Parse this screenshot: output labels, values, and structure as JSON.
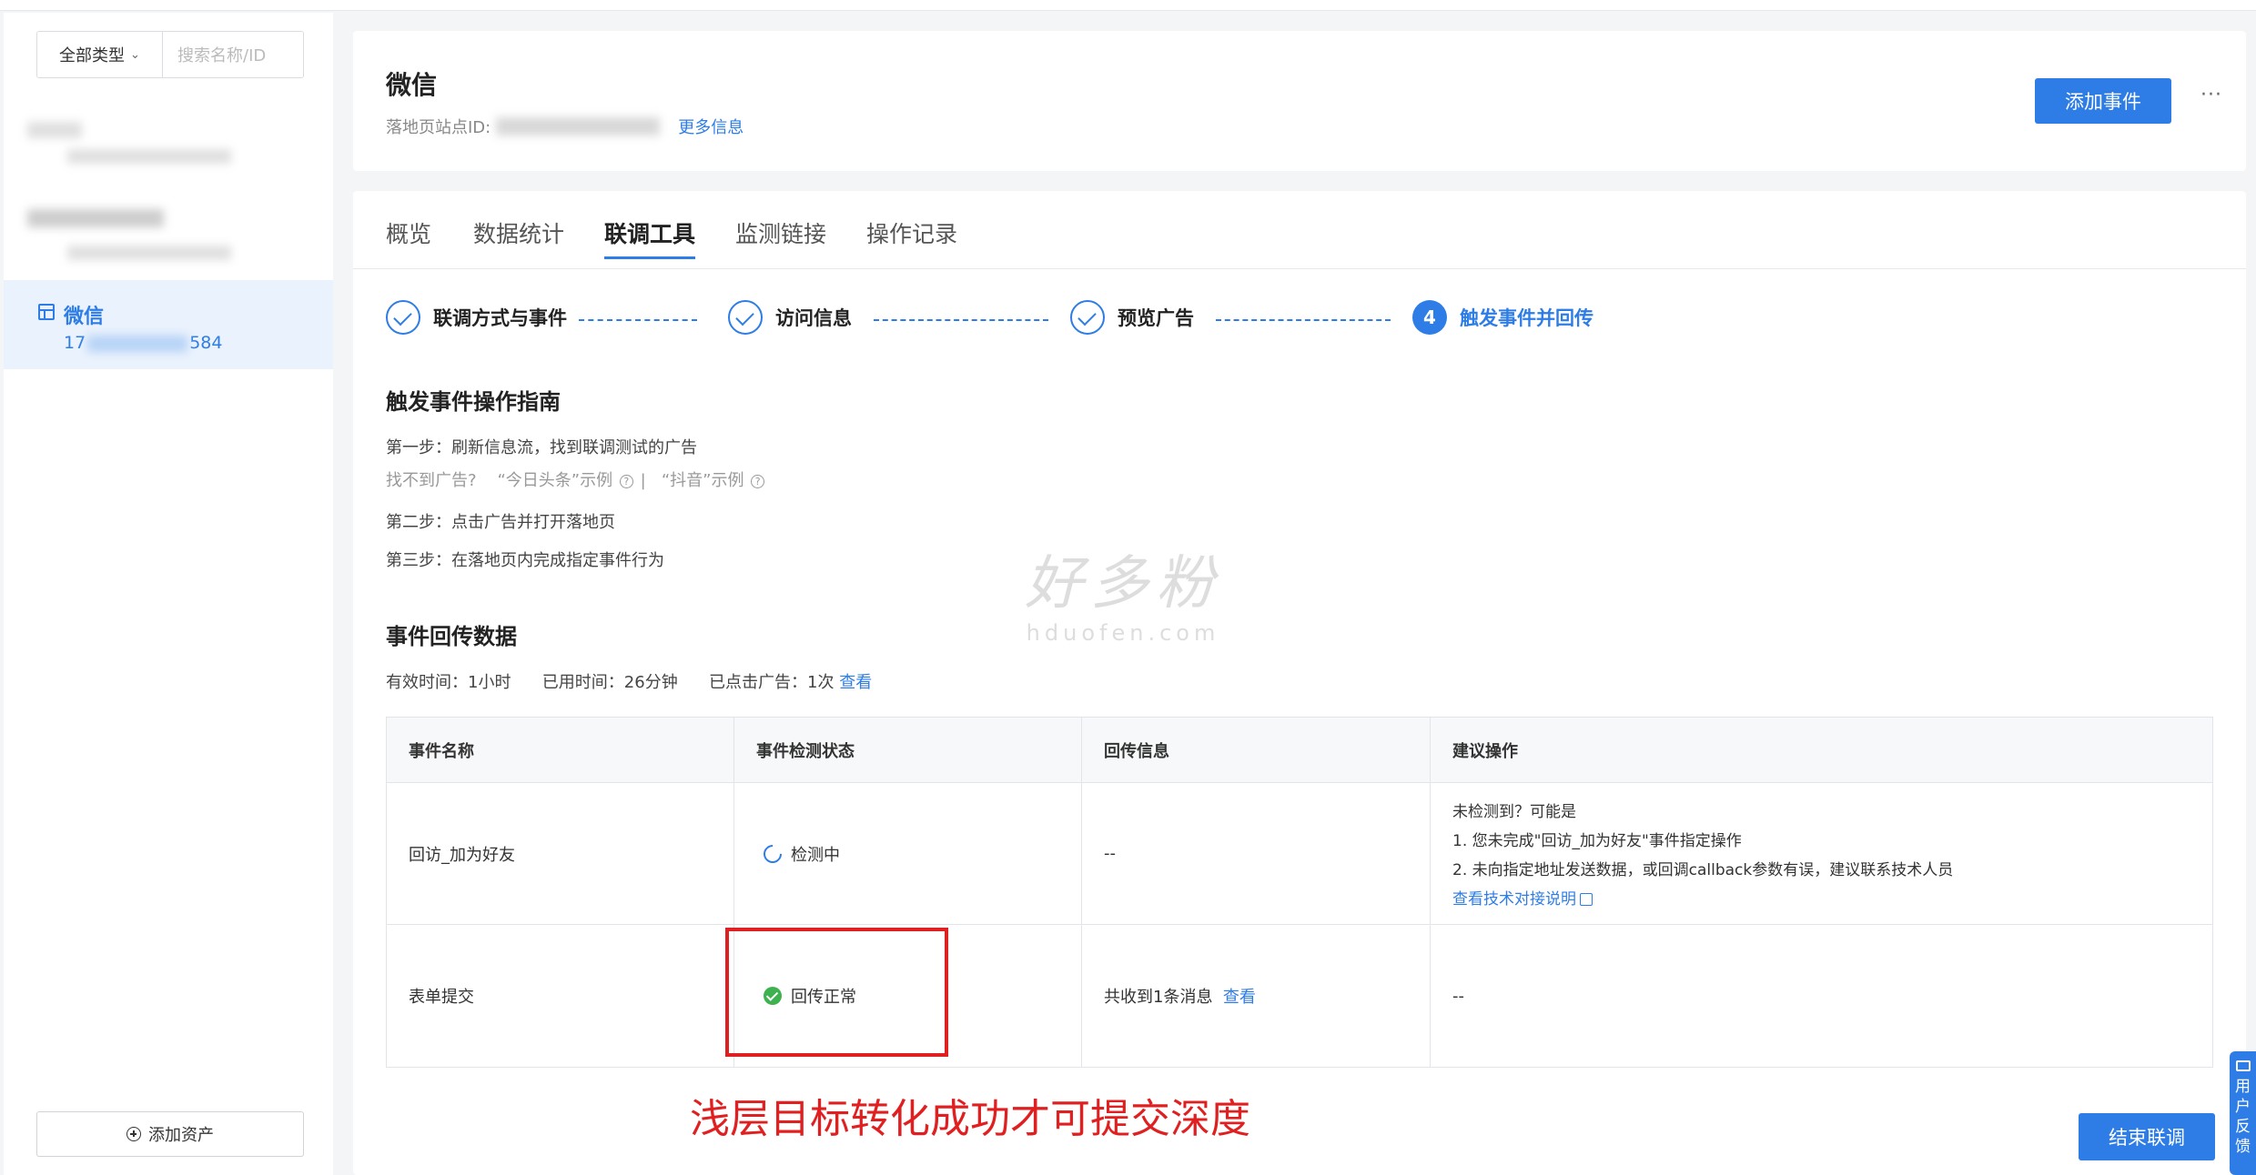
{
  "sidebar": {
    "type_filter": "全部类型",
    "search_placeholder": "搜索名称/ID",
    "active_item": {
      "name": "微信",
      "id_prefix": "17",
      "id_suffix": "584"
    },
    "add_asset": "添加资产"
  },
  "header": {
    "title": "微信",
    "site_id_label": "落地页站点ID:",
    "more_info": "更多信息",
    "add_event": "添加事件",
    "more_menu": "···"
  },
  "tabs": [
    "概览",
    "数据统计",
    "联调工具",
    "监测链接",
    "操作记录"
  ],
  "active_tab": "联调工具",
  "steps": [
    {
      "label": "联调方式与事件",
      "state": "done"
    },
    {
      "label": "访问信息",
      "state": "done"
    },
    {
      "label": "预览广告",
      "state": "done"
    },
    {
      "label": "触发事件并回传",
      "state": "active",
      "number": "4"
    }
  ],
  "guide": {
    "title": "触发事件操作指南",
    "step1": "第一步：刷新信息流，找到联调测试的广告",
    "hint_prefix": "找不到广告?",
    "hint_toutiao": "“今日头条”示例",
    "hint_sep": "|",
    "hint_douyin": "“抖音”示例",
    "step2": "第二步：点击广告并打开落地页",
    "step3": "第三步：在落地页内完成指定事件行为"
  },
  "event_data": {
    "title": "事件回传数据",
    "valid_time": "有效时间：1小时",
    "used_time": "已用时间：26分钟",
    "clicked": "已点击广告：1次",
    "view": "查看"
  },
  "table": {
    "headers": [
      "事件名称",
      "事件检测状态",
      "回传信息",
      "建议操作"
    ],
    "rows": [
      {
        "name": "回访_加为好友",
        "status": "检测中",
        "info": "--",
        "suggest_title": "未检测到？可能是",
        "suggest_1": "1. 您未完成\"回访_加为好友\"事件指定操作",
        "suggest_2": "2. 未向指定地址发送数据，或回调callback参数有误，建议联系技术人员",
        "suggest_link": "查看技术对接说明"
      },
      {
        "name": "表单提交",
        "status": "回传正常",
        "info": "共收到1条消息",
        "info_link": "查看",
        "suggest": "--"
      }
    ]
  },
  "annotation": "浅层目标转化成功才可提交深度",
  "end_button": "结束联调",
  "feedback": [
    "用",
    "户",
    "反",
    "馈"
  ],
  "watermark": {
    "main": "好多粉",
    "sub": "hduofen.com"
  },
  "colors": {
    "accent": "#2e7de6",
    "success": "#3db24f",
    "annotation": "#e02020"
  }
}
